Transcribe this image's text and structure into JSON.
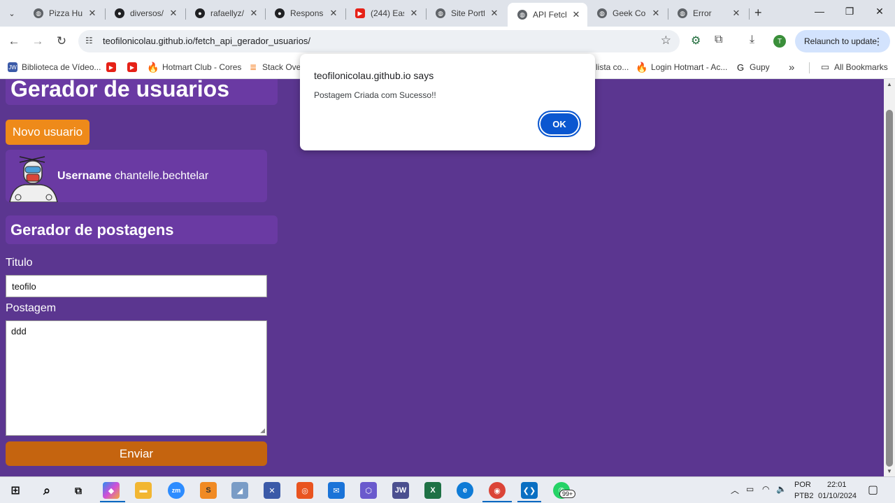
{
  "browser": {
    "tabs": [
      {
        "title": "Pizza Hut",
        "icon": "globe-icon",
        "color": "#5f6368"
      },
      {
        "title": "diversos/",
        "icon": "github-icon",
        "color": "#202124"
      },
      {
        "title": "rafaellyz/",
        "icon": "github-icon",
        "color": "#202124"
      },
      {
        "title": "Responsi",
        "icon": "github-icon",
        "color": "#202124"
      },
      {
        "title": "(244) Eas",
        "icon": "youtube-icon",
        "color": "#e62117"
      },
      {
        "title": "Site Portf",
        "icon": "globe-icon",
        "color": "#5f6368"
      },
      {
        "title": "API Fetch",
        "icon": "globe-icon",
        "color": "#5f6368",
        "active": true
      },
      {
        "title": "Geek Con",
        "icon": "globe-icon",
        "color": "#5f6368"
      },
      {
        "title": "Error",
        "icon": "globe-icon",
        "color": "#5f6368"
      }
    ],
    "url": "teofilonicolau.github.io/fetch_api_gerador_usuarios/",
    "relaunch_label": "Relaunch to update",
    "profile_initial": "T",
    "bookmarks": [
      {
        "label": "Biblioteca de Vídeo...",
        "icon": "jw-icon",
        "color": "#3b5aa8"
      },
      {
        "label": "",
        "icon": "youtube-icon",
        "color": "#e62117"
      },
      {
        "label": "",
        "icon": "youtube-icon",
        "color": "#e62117"
      },
      {
        "label": "Hotmart Club - Cores",
        "icon": "flame-icon",
        "color": "#f04e23"
      },
      {
        "label": "Stack Overf",
        "icon": "stackoverflow-icon",
        "color": "#f48024"
      },
      {
        "label": "lista co...",
        "icon": "",
        "color": "#ffffff"
      },
      {
        "label": "Login Hotmart - Ac...",
        "icon": "flame-icon",
        "color": "#f04e23"
      },
      {
        "label": "Gupy",
        "icon": "gupy-icon",
        "color": "#1b1b1b"
      }
    ],
    "all_bookmarks_label": "All Bookmarks"
  },
  "page": {
    "users_title": "Gerador de usuarios",
    "new_user_button": "Novo usuario",
    "user_card": {
      "label": "Username",
      "value": "chantelle.bechtelar"
    },
    "posts_title": "Gerador de postagens",
    "title_label": "Titulo",
    "title_value": "teofilo",
    "post_label": "Postagem",
    "post_value": "ddd",
    "submit_button": "Enviar"
  },
  "alert": {
    "origin": "teofilonicolau.github.io says",
    "message": "Postagem Criada com Sucesso!!",
    "ok_label": "OK"
  },
  "taskbar": {
    "language": "POR",
    "layout": "PTB2",
    "time": "22:01",
    "date": "01/10/2024",
    "whatsapp_badge": "99+"
  },
  "colors": {
    "page_bg": "#5b3690",
    "panel_bg": "#6a3aa3",
    "new_user_button": "#ee8a1a",
    "submit_button": "#c5640f",
    "ok_button": "#0b57d0"
  }
}
